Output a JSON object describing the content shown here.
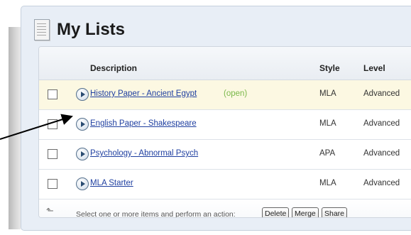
{
  "page_title": "My Lists",
  "table": {
    "headers": {
      "description": "Description",
      "style": "Style",
      "level": "Level"
    },
    "rows": [
      {
        "title": "History Paper - Ancient Egypt",
        "status": "(open)",
        "style": "MLA",
        "level": "Advanced"
      },
      {
        "title": "English Paper - Shakespeare",
        "status": "",
        "style": "MLA",
        "level": "Advanced"
      },
      {
        "title": "Psychology - Abnormal Psych",
        "status": "",
        "style": "APA",
        "level": "Advanced"
      },
      {
        "title": "MLA Starter",
        "status": "",
        "style": "MLA",
        "level": "Advanced"
      }
    ]
  },
  "footer": {
    "instruction": "Select one or more items and perform an action:",
    "buttons": [
      "Delete",
      "Merge",
      "Share"
    ]
  },
  "icons": {
    "title": "list-document-icon",
    "row": "play-circle-icon",
    "footer": "select-all-arrow-icon"
  },
  "colors": {
    "link": "#1f3fa0",
    "open_status": "#7ab84a",
    "open_row_background": "#fcf8e2",
    "panel_background": "#e8eef6"
  }
}
